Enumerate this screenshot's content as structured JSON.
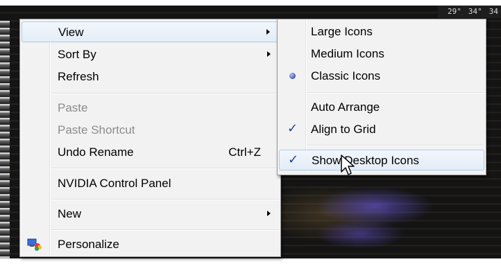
{
  "top_right": {
    "values": [
      "29°",
      "34°",
      "34"
    ]
  },
  "main_menu": {
    "view": "View",
    "sort_by": "Sort By",
    "refresh": "Refresh",
    "paste": "Paste",
    "paste_shortcut": "Paste Shortcut",
    "undo_rename": "Undo Rename",
    "undo_rename_shortcut": "Ctrl+Z",
    "nvidia": "NVIDIA Control Panel",
    "new": "New",
    "personalize": "Personalize"
  },
  "view_submenu": {
    "large_icons": "Large Icons",
    "medium_icons": "Medium Icons",
    "classic_icons": "Classic Icons",
    "auto_arrange": "Auto Arrange",
    "align_to_grid": "Align to Grid",
    "show_desktop_icons": "Show Desktop Icons",
    "selected_view": "Classic Icons",
    "checked": [
      "Align to Grid",
      "Show Desktop Icons"
    ]
  },
  "colors": {
    "menu_background": "#f2f2f2",
    "hover_border": "#aecbe8",
    "disabled_text": "#8c8c8c",
    "check_mark": "#1e3f9e"
  }
}
